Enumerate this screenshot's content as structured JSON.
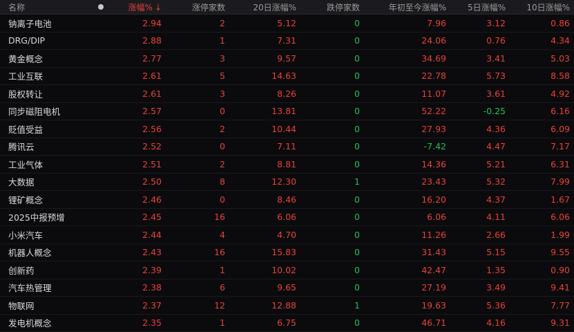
{
  "header": {
    "name": "名称",
    "change": "涨幅%",
    "sort_arrow": "↓",
    "limit_up": "涨停家数",
    "change_20d": "20日涨幅%",
    "limit_down": "跌停家数",
    "ytd": "年初至今涨幅%",
    "change_5d": "5日涨幅%",
    "change_10d": "10日涨幅%",
    "dot_icon": "circle-dot-icon"
  },
  "colors": {
    "up": "#e8413b",
    "down": "#20c05a",
    "neutral": "#d9d9d9",
    "background": "#0b0b0d"
  },
  "rows": [
    {
      "name": "钠离子电池",
      "change": "2.94",
      "limit_up": "2",
      "change_20d": "5.12",
      "limit_down": "0",
      "ytd": "7.96",
      "change_5d": "3.12",
      "change_10d": "0.86"
    },
    {
      "name": "DRG/DIP",
      "change": "2.88",
      "limit_up": "1",
      "change_20d": "7.31",
      "limit_down": "0",
      "ytd": "24.06",
      "change_5d": "0.76",
      "change_10d": "4.34"
    },
    {
      "name": "黄金概念",
      "change": "2.77",
      "limit_up": "3",
      "change_20d": "9.57",
      "limit_down": "0",
      "ytd": "34.69",
      "change_5d": "3.41",
      "change_10d": "5.03"
    },
    {
      "name": "工业互联",
      "change": "2.61",
      "limit_up": "5",
      "change_20d": "14.63",
      "limit_down": "0",
      "ytd": "22.78",
      "change_5d": "5.73",
      "change_10d": "8.58"
    },
    {
      "name": "股权转让",
      "change": "2.61",
      "limit_up": "3",
      "change_20d": "8.26",
      "limit_down": "0",
      "ytd": "11.07",
      "change_5d": "3.61",
      "change_10d": "4.92"
    },
    {
      "name": "同步磁阻电机",
      "change": "2.57",
      "limit_up": "0",
      "change_20d": "13.81",
      "limit_down": "0",
      "ytd": "52.22",
      "change_5d": "-0.25",
      "change_10d": "6.16"
    },
    {
      "name": "贬值受益",
      "change": "2.56",
      "limit_up": "2",
      "change_20d": "10.44",
      "limit_down": "0",
      "ytd": "27.93",
      "change_5d": "4.36",
      "change_10d": "6.09"
    },
    {
      "name": "腾讯云",
      "change": "2.52",
      "limit_up": "0",
      "change_20d": "7.11",
      "limit_down": "0",
      "ytd": "-7.42",
      "change_5d": "4.47",
      "change_10d": "7.17"
    },
    {
      "name": "工业气体",
      "change": "2.51",
      "limit_up": "2",
      "change_20d": "8.81",
      "limit_down": "0",
      "ytd": "14.36",
      "change_5d": "5.21",
      "change_10d": "6.31"
    },
    {
      "name": "大数据",
      "change": "2.50",
      "limit_up": "8",
      "change_20d": "12.30",
      "limit_down": "1",
      "ytd": "23.43",
      "change_5d": "5.32",
      "change_10d": "7.99"
    },
    {
      "name": "锂矿概念",
      "change": "2.46",
      "limit_up": "0",
      "change_20d": "8.46",
      "limit_down": "0",
      "ytd": "16.20",
      "change_5d": "4.37",
      "change_10d": "1.67"
    },
    {
      "name": "2025中报预增",
      "change": "2.45",
      "limit_up": "16",
      "change_20d": "6.06",
      "limit_down": "0",
      "ytd": "6.06",
      "change_5d": "4.11",
      "change_10d": "6.06"
    },
    {
      "name": "小米汽车",
      "change": "2.44",
      "limit_up": "4",
      "change_20d": "4.70",
      "limit_down": "0",
      "ytd": "11.26",
      "change_5d": "2.66",
      "change_10d": "1.99"
    },
    {
      "name": "机器人概念",
      "change": "2.43",
      "limit_up": "16",
      "change_20d": "15.83",
      "limit_down": "0",
      "ytd": "31.43",
      "change_5d": "5.15",
      "change_10d": "9.55"
    },
    {
      "name": "创新药",
      "change": "2.39",
      "limit_up": "1",
      "change_20d": "10.02",
      "limit_down": "0",
      "ytd": "42.47",
      "change_5d": "1.35",
      "change_10d": "0.90"
    },
    {
      "name": "汽车热管理",
      "change": "2.38",
      "limit_up": "6",
      "change_20d": "9.65",
      "limit_down": "0",
      "ytd": "27.19",
      "change_5d": "3.49",
      "change_10d": "9.41"
    },
    {
      "name": "物联网",
      "change": "2.37",
      "limit_up": "12",
      "change_20d": "12.88",
      "limit_down": "1",
      "ytd": "19.63",
      "change_5d": "5.36",
      "change_10d": "7.77"
    },
    {
      "name": "发电机概念",
      "change": "2.35",
      "limit_up": "1",
      "change_20d": "6.75",
      "limit_down": "0",
      "ytd": "46.71",
      "change_5d": "4.16",
      "change_10d": "9.31"
    }
  ]
}
